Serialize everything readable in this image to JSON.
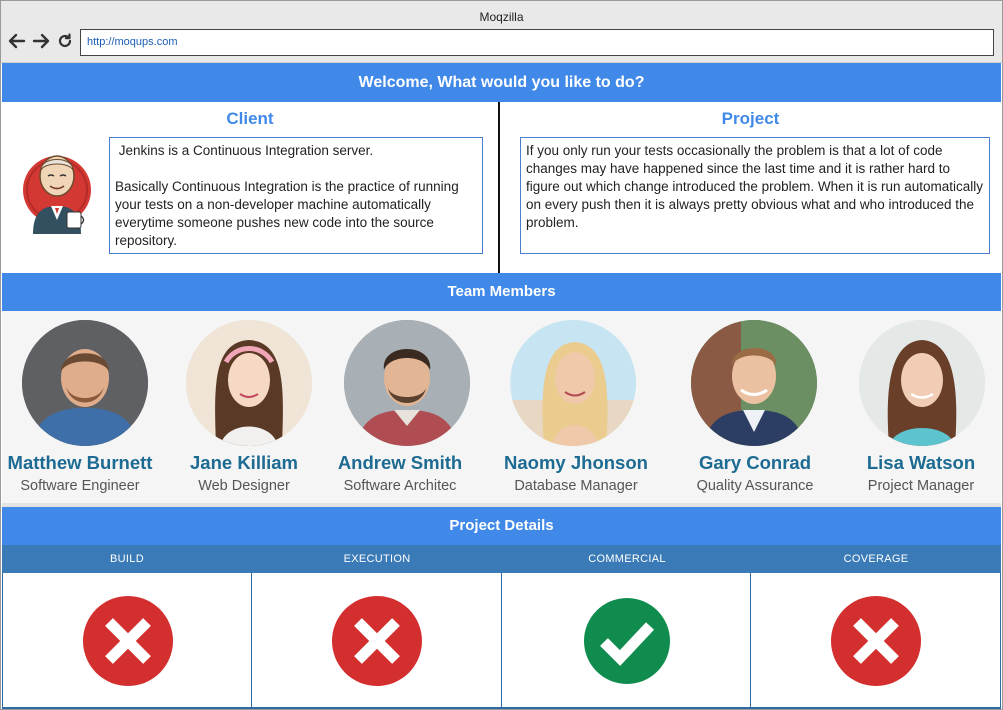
{
  "browser": {
    "title": "Moqzilla",
    "url": "http://moqups.com"
  },
  "welcome": {
    "heading": "Welcome, What would you like to do?"
  },
  "client": {
    "title": "Client",
    "text": " Jenkins is a Continuous Integration server.\n\nBasically Continuous Integration is the practice of running your tests on a non-developer machine automatically everytime someone pushes new code into the source repository."
  },
  "project": {
    "title": "Project",
    "text": "If you only run your tests occasionally the problem is that a lot of code changes may have happened since the last time and it is rather hard to figure out which change introduced the problem. When it is run automatically on every push then it is always pretty obvious what and who introduced the problem."
  },
  "team": {
    "heading": "Team Members",
    "members": [
      {
        "name": "Matthew Burnett",
        "role": "Software Engineer"
      },
      {
        "name": "Jane Killiam",
        "role": "Web Designer"
      },
      {
        "name": "Andrew Smith",
        "role": "Software Architec"
      },
      {
        "name": "Naomy Jhonson",
        "role": "Database Manager"
      },
      {
        "name": "Gary Conrad",
        "role": "Quality Assurance"
      },
      {
        "name": "Lisa Watson",
        "role": "Project Manager"
      }
    ]
  },
  "details": {
    "heading": "Project Details",
    "columns": [
      {
        "label": "BUILD",
        "status": "fail",
        "icon": "fail-x-icon",
        "color": "#d32f2f"
      },
      {
        "label": "EXECUTION",
        "status": "fail",
        "icon": "fail-x-icon",
        "color": "#d32f2f"
      },
      {
        "label": "COMMERCIAL",
        "status": "pass",
        "icon": "check-icon",
        "color": "#0f8c4e"
      },
      {
        "label": "COVERAGE",
        "status": "fail",
        "icon": "fail-x-icon",
        "color": "#d32f2f"
      }
    ]
  },
  "colors": {
    "accent": "#4189e8",
    "table_header": "#3a7ab6",
    "member_name": "#1d6b92"
  }
}
